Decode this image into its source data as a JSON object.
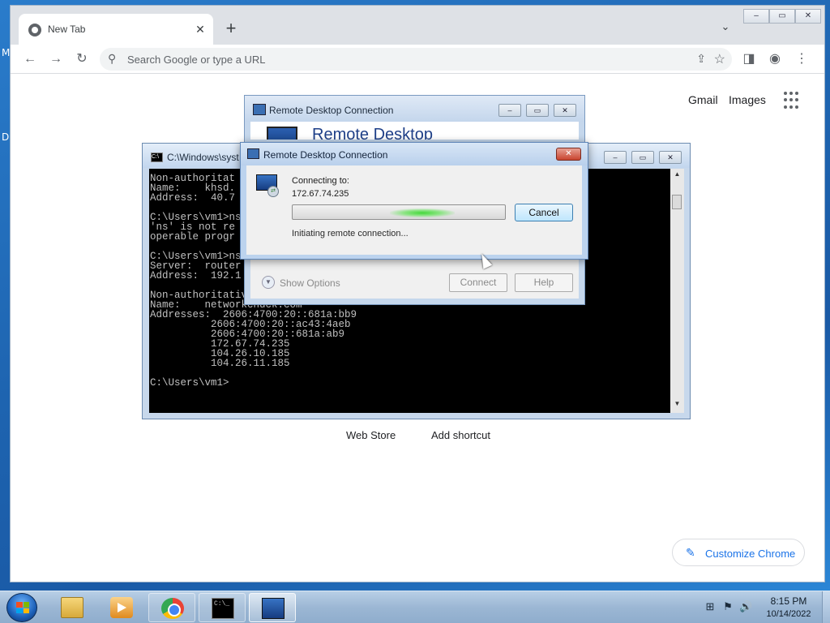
{
  "desktop": {
    "glyphs": [
      "M",
      "D"
    ]
  },
  "browser": {
    "tab_title": "New Tab",
    "tab_close_glyph": "✕",
    "new_tab_glyph": "+",
    "tab_dropdown_glyph": "⌄",
    "window_controls": [
      "–",
      "▭",
      "✕"
    ],
    "nav": {
      "back": "←",
      "forward": "→",
      "reload": "↻"
    },
    "omnibox_placeholder": "Search Google or type a URL",
    "toolbar_right": {
      "share": "⇪",
      "star": "☆",
      "sidepanel": "◨",
      "profile": "◉",
      "menu": "⋮"
    },
    "header_links": [
      "Gmail",
      "Images"
    ],
    "shortcuts": [
      "Web Store",
      "Add shortcut"
    ],
    "customize_label": "Customize Chrome",
    "customize_icon": "pencil-icon"
  },
  "cmd_window": {
    "title": "C:\\Windows\\syst",
    "icon_text": "C:\\",
    "controls": [
      "–",
      "▭",
      "✕"
    ],
    "console_text": "Non-authoritat\nName:    khsd.\nAddress:  40.7\n\nC:\\Users\\vm1>ns\n'ns' is not re\noperable progr\n\nC:\\Users\\vm1>ns\nServer:  router\nAddress:  192.1\n\nNon-authoritative answer:\nName:    networkchuck.com\nAddresses:  2606:4700:20::681a:bb9\n          2606:4700:20::ac43:4aeb\n          2606:4700:20::681a:ab9\n          172.67.74.235\n          104.26.10.185\n          104.26.11.185\n\nC:\\Users\\vm1>",
    "scroll_up": "▲",
    "scroll_down": "▼"
  },
  "rdc_back": {
    "title": "Remote Desktop Connection",
    "banner_title": "Remote Desktop",
    "controls": [
      "–",
      "▭",
      "✕"
    ],
    "show_options_label": "Show Options",
    "connect_label": "Connect",
    "help_label": "Help"
  },
  "rdc_front": {
    "title": "Remote Desktop Connection",
    "close_glyph": "✕",
    "connecting_label": "Connecting to:",
    "target_ip": "172.67.74.235",
    "cancel_label": "Cancel",
    "status_text": "Initiating remote connection..."
  },
  "taskbar": {
    "apps": [
      {
        "name": "windows-explorer",
        "icon": "folder-icon"
      },
      {
        "name": "media-player",
        "icon": "media-player-icon"
      },
      {
        "name": "google-chrome",
        "icon": "chrome-icon"
      },
      {
        "name": "command-prompt",
        "icon": "cmd-icon",
        "icon_text": "C:\\_"
      },
      {
        "name": "remote-desktop",
        "icon": "remote-desktop-icon"
      }
    ],
    "tray": {
      "network": "⊞",
      "flag": "⚑",
      "volume": "🔊"
    },
    "time": "8:15 PM",
    "date": "10/14/2022"
  }
}
